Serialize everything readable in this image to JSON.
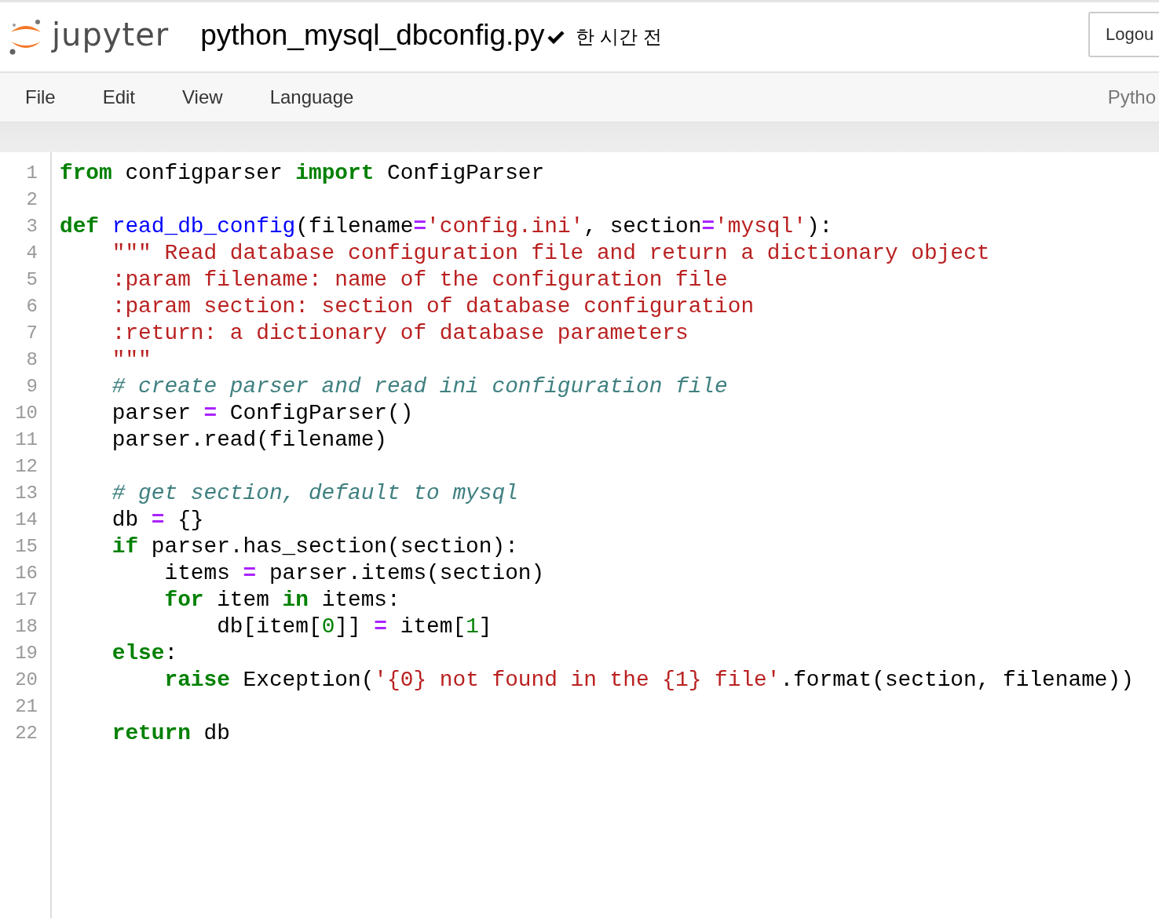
{
  "header": {
    "logo_text": "jupyter",
    "filename": "python_mysql_dbconfig.py",
    "saved": true,
    "last_saved": "한 시간 전",
    "logout_button": "Logou"
  },
  "menu": {
    "items": [
      "File",
      "Edit",
      "View",
      "Language"
    ],
    "kernel": "Pytho"
  },
  "editor": {
    "lines": [
      {
        "number": "1",
        "tokens": [
          {
            "kind": "kw",
            "text": "from"
          },
          {
            "kind": "plain",
            "text": " configparser "
          },
          {
            "kind": "kw",
            "text": "import"
          },
          {
            "kind": "plain",
            "text": " ConfigParser"
          }
        ]
      },
      {
        "number": "2"
      },
      {
        "number": "3",
        "tokens": [
          {
            "kind": "kw",
            "text": "def "
          },
          {
            "kind": "def",
            "text": "read_db_config"
          },
          {
            "kind": "plain",
            "text": "(filename"
          },
          {
            "kind": "op",
            "text": "="
          },
          {
            "kind": "str",
            "text": "'config.ini'"
          },
          {
            "kind": "plain",
            "text": ", section"
          },
          {
            "kind": "op",
            "text": "="
          },
          {
            "kind": "str",
            "text": "'mysql'"
          },
          {
            "kind": "plain",
            "text": "):"
          }
        ]
      },
      {
        "number": "4",
        "tokens": [
          {
            "kind": "str",
            "text": "    \"\"\" Read database configuration file and return a dictionary object"
          }
        ]
      },
      {
        "number": "5",
        "tokens": [
          {
            "kind": "str",
            "text": "    :param filename: name of the configuration file"
          }
        ]
      },
      {
        "number": "6",
        "tokens": [
          {
            "kind": "str",
            "text": "    :param section: section of database configuration"
          }
        ]
      },
      {
        "number": "7",
        "tokens": [
          {
            "kind": "str",
            "text": "    :return: a dictionary of database parameters"
          }
        ]
      },
      {
        "number": "8",
        "tokens": [
          {
            "kind": "str",
            "text": "    \"\"\""
          }
        ]
      },
      {
        "number": "9",
        "tokens": [
          {
            "kind": "comment",
            "text": "    # create parser and read ini configuration file"
          }
        ]
      },
      {
        "number": "10",
        "tokens": [
          {
            "kind": "plain",
            "text": "    parser "
          },
          {
            "kind": "op",
            "text": "="
          },
          {
            "kind": "plain",
            "text": " ConfigParser()"
          }
        ]
      },
      {
        "number": "11",
        "tokens": [
          {
            "kind": "plain",
            "text": "    parser.read(filename)"
          }
        ]
      },
      {
        "number": "12"
      },
      {
        "number": "13",
        "tokens": [
          {
            "kind": "comment",
            "text": "    # get section, default to mysql"
          }
        ]
      },
      {
        "number": "14",
        "tokens": [
          {
            "kind": "plain",
            "text": "    db "
          },
          {
            "kind": "op",
            "text": "="
          },
          {
            "kind": "plain",
            "text": " {}"
          }
        ]
      },
      {
        "number": "15",
        "tokens": [
          {
            "kind": "kw",
            "text": "    if"
          },
          {
            "kind": "plain",
            "text": " parser.has_section(section):"
          }
        ]
      },
      {
        "number": "16",
        "tokens": [
          {
            "kind": "plain",
            "text": "        items "
          },
          {
            "kind": "op",
            "text": "="
          },
          {
            "kind": "plain",
            "text": " parser.items(section)"
          }
        ]
      },
      {
        "number": "17",
        "tokens": [
          {
            "kind": "kw",
            "text": "        for"
          },
          {
            "kind": "plain",
            "text": " item "
          },
          {
            "kind": "kw",
            "text": "in"
          },
          {
            "kind": "plain",
            "text": " items:"
          }
        ]
      },
      {
        "number": "18",
        "tokens": [
          {
            "kind": "plain",
            "text": "            db[item["
          },
          {
            "kind": "num",
            "text": "0"
          },
          {
            "kind": "plain",
            "text": "]] "
          },
          {
            "kind": "op",
            "text": "="
          },
          {
            "kind": "plain",
            "text": " item["
          },
          {
            "kind": "num",
            "text": "1"
          },
          {
            "kind": "plain",
            "text": "]"
          }
        ]
      },
      {
        "number": "19",
        "tokens": [
          {
            "kind": "kw",
            "text": "    else"
          },
          {
            "kind": "plain",
            "text": ":"
          }
        ]
      },
      {
        "number": "20",
        "tokens": [
          {
            "kind": "kw",
            "text": "        raise"
          },
          {
            "kind": "plain",
            "text": " Exception("
          },
          {
            "kind": "str",
            "text": "'{0} not found in the {1} file'"
          },
          {
            "kind": "plain",
            "text": ".format(section, filename))"
          }
        ]
      },
      {
        "number": "21"
      },
      {
        "number": "22",
        "tokens": [
          {
            "kind": "kw",
            "text": "    return"
          },
          {
            "kind": "plain",
            "text": " db"
          }
        ]
      }
    ]
  }
}
